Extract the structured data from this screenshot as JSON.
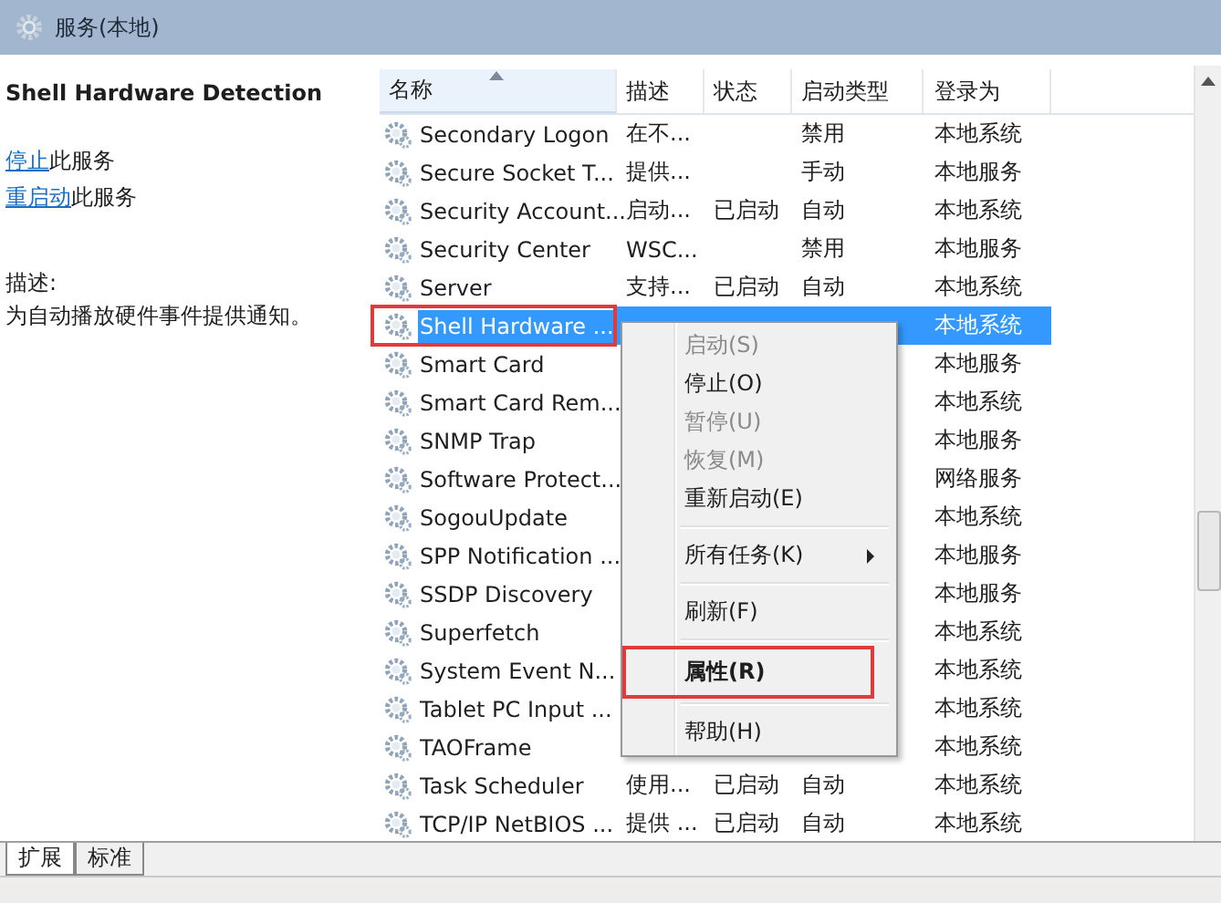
{
  "window": {
    "title": "服务(本地)"
  },
  "detail": {
    "service_name": "Shell Hardware Detection",
    "actions": [
      {
        "link": "停止",
        "text": "此服务"
      },
      {
        "link": "重启动",
        "text": "此服务"
      }
    ],
    "description_label": "描述:",
    "description": "为自动播放硬件事件提供通知。"
  },
  "table": {
    "columns": [
      {
        "label": "名称",
        "sorted": true
      },
      {
        "label": "描述",
        "sorted": false
      },
      {
        "label": "状态",
        "sorted": false
      },
      {
        "label": "启动类型",
        "sorted": false
      },
      {
        "label": "登录为",
        "sorted": false
      }
    ],
    "rows": [
      {
        "name": "Secondary Logon",
        "description": "在不...",
        "status": "",
        "startup": "禁用",
        "logon": "本地系统",
        "selected": false,
        "annotated": false
      },
      {
        "name": "Secure Socket T...",
        "description": "提供...",
        "status": "",
        "startup": "手动",
        "logon": "本地服务",
        "selected": false,
        "annotated": false
      },
      {
        "name": "Security Account...",
        "description": "启动...",
        "status": "已启动",
        "startup": "自动",
        "logon": "本地系统",
        "selected": false,
        "annotated": false
      },
      {
        "name": "Security Center",
        "description": "WSC...",
        "status": "",
        "startup": "禁用",
        "logon": "本地服务",
        "selected": false,
        "annotated": false
      },
      {
        "name": "Server",
        "description": "支持...",
        "status": "已启动",
        "startup": "自动",
        "logon": "本地系统",
        "selected": false,
        "annotated": false
      },
      {
        "name": "Shell Hardware ...",
        "logon": "本地系统",
        "selected": true,
        "annotated": true
      },
      {
        "name": "Smart Card",
        "logon": "本地服务",
        "selected": false,
        "annotated": false
      },
      {
        "name": "Smart Card Rem...",
        "logon": "本地系统",
        "selected": false,
        "annotated": false
      },
      {
        "name": "SNMP Trap",
        "logon": "本地服务",
        "selected": false,
        "annotated": false
      },
      {
        "name": "Software Protect...",
        "logon": "网络服务",
        "selected": false,
        "annotated": false
      },
      {
        "name": "SogouUpdate",
        "logon": "本地系统",
        "selected": false,
        "annotated": false
      },
      {
        "name": "SPP Notification ...",
        "logon": "本地服务",
        "selected": false,
        "annotated": false
      },
      {
        "name": "SSDP Discovery",
        "logon": "本地服务",
        "selected": false,
        "annotated": false
      },
      {
        "name": "Superfetch",
        "logon": "本地系统",
        "selected": false,
        "annotated": false
      },
      {
        "name": "System Event N...",
        "logon": "本地系统",
        "selected": false,
        "annotated": false
      },
      {
        "name": "Tablet PC Input ...",
        "logon": "本地系统",
        "selected": false,
        "annotated": false
      },
      {
        "name": "TAOFrame",
        "logon": "本地系统",
        "selected": false,
        "annotated": false
      },
      {
        "name": "Task Scheduler",
        "description": "使用...",
        "status": "已启动",
        "startup": "自动",
        "logon": "本地系统",
        "selected": false,
        "annotated": false
      },
      {
        "name": "TCP/IP NetBIOS ...",
        "description": "提供 ...",
        "status": "已启动",
        "startup": "自动",
        "logon": "本地系统",
        "selected": false,
        "annotated": false
      }
    ]
  },
  "context_menu": {
    "items": [
      {
        "kind": "item",
        "label": "启动(S)",
        "disabled": true,
        "bold": false,
        "annotated": false
      },
      {
        "kind": "item",
        "label": "停止(O)",
        "disabled": false,
        "bold": false,
        "annotated": false
      },
      {
        "kind": "item",
        "label": "暂停(U)",
        "disabled": true,
        "bold": false,
        "annotated": false
      },
      {
        "kind": "item",
        "label": "恢复(M)",
        "disabled": true,
        "bold": false,
        "annotated": false
      },
      {
        "kind": "item",
        "label": "重新启动(E)",
        "disabled": false,
        "bold": false,
        "annotated": false
      },
      {
        "kind": "separator"
      },
      {
        "kind": "submenu",
        "label": "所有任务(K)",
        "disabled": false,
        "bold": false,
        "annotated": false
      },
      {
        "kind": "separator"
      },
      {
        "kind": "item",
        "label": "刷新(F)",
        "disabled": false,
        "bold": false,
        "annotated": false
      },
      {
        "kind": "separator"
      },
      {
        "kind": "item",
        "label": "属性(R)",
        "disabled": false,
        "bold": true,
        "annotated": true
      },
      {
        "kind": "separator"
      },
      {
        "kind": "item",
        "label": "帮助(H)",
        "disabled": false,
        "bold": false,
        "annotated": false
      }
    ]
  },
  "view_tabs": [
    {
      "label": "扩展",
      "selected": true
    },
    {
      "label": "标准",
      "selected": false
    }
  ]
}
